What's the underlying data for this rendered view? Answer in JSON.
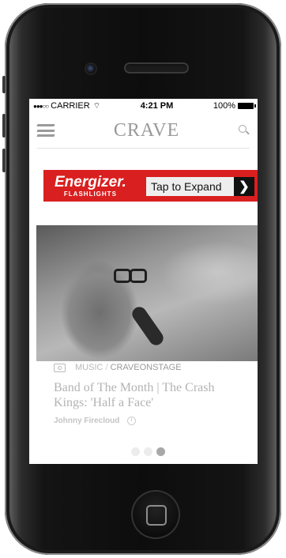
{
  "status_bar": {
    "carrier": "CARRIER",
    "time": "4:21 PM",
    "battery": "100%"
  },
  "app_bar": {
    "logo": "CRAVE",
    "menu_icon": "hamburger-menu-icon",
    "search_icon": "search-icon"
  },
  "ad": {
    "brand": "Energizer.",
    "brand_sub": "FLASHLIGHTS",
    "cta": "Tap to Expand",
    "arrow": "❯",
    "accent": "#d91f1f"
  },
  "article": {
    "category": "MUSIC",
    "separator": "/",
    "subcategory": "CRAVEONSTAGE",
    "title": "Band of The Month | The Crash Kings: 'Half a Face'",
    "author": "Johnny Firecloud"
  },
  "pager": {
    "count": 3,
    "active_index": 2
  }
}
